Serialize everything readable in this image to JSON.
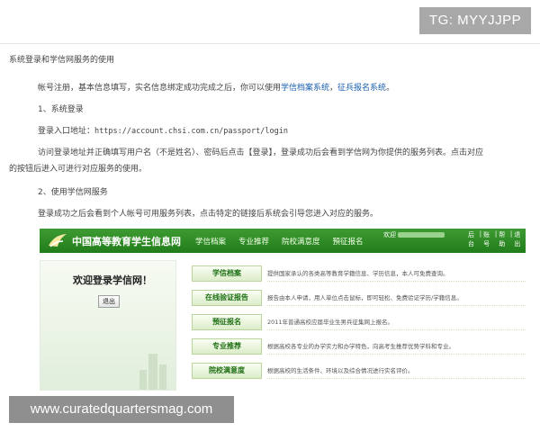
{
  "overlay": {
    "tg": "TG: MYYJJPP",
    "watermark": "www.curatedquartersmag.com"
  },
  "article": {
    "title": "系统登录和学信网服务的使用",
    "p1": {
      "before": "帐号注册，基本信息填写，实名信息绑定成功完成之后，你可以使用",
      "link1": "学信档案系统",
      "mid": "，",
      "link2": "征兵报名系统",
      "after": "。"
    },
    "h1": "1、系统登录",
    "login_label": "登录入口地址：",
    "login_url": "https://account.chsi.com.cn/passport/login",
    "p2_line1": "访问登录地址并正确填写用户名（不是姓名）、密码后点击【登录】，登录成功后会看到学信网为你提供的服务列表。点击对应",
    "p2_line2": "的按钮后进入可进行对应服务的使用。",
    "h2": "2、使用学信网服务",
    "p3": "登录成功之后会看到个人帐号可用服务列表，点击特定的链接后系统会引导您进入对应的服务。"
  },
  "portal": {
    "site_name": "中国高等教育学生信息网",
    "nav": [
      "学信档案",
      "专业推荐",
      "院校满意度",
      "預征报名"
    ],
    "welcome": "欢迎",
    "toplinks": [
      "后台",
      "账号",
      "帮助",
      "退出"
    ],
    "login_title": "欢迎登录学信网！",
    "logout": "退出",
    "services": [
      {
        "label": "学信档案",
        "desc": "提供国家承认的各类高等教育学籍信息、学历信息，本人可免费查询。"
      },
      {
        "label": "在线验证报告",
        "desc": "报告由本人申请，用人单位点击鼠标，即可轻松、免费验证学历/学籍信息。"
      },
      {
        "label": "預征报名",
        "desc": "2011年普通高校应届毕业生男兵征集网上报名。"
      },
      {
        "label": "专业推荐",
        "desc": "根据高校各专业的办学实力和办学特色，向高考生推荐优势学科和专业。"
      },
      {
        "label": "院校满意度",
        "desc": "根据高校的生活条件、环境以及综合情况进行实名评价。"
      }
    ]
  },
  "colors": {
    "link": "#1a5faf",
    "portal_green": "#2a8a22"
  }
}
